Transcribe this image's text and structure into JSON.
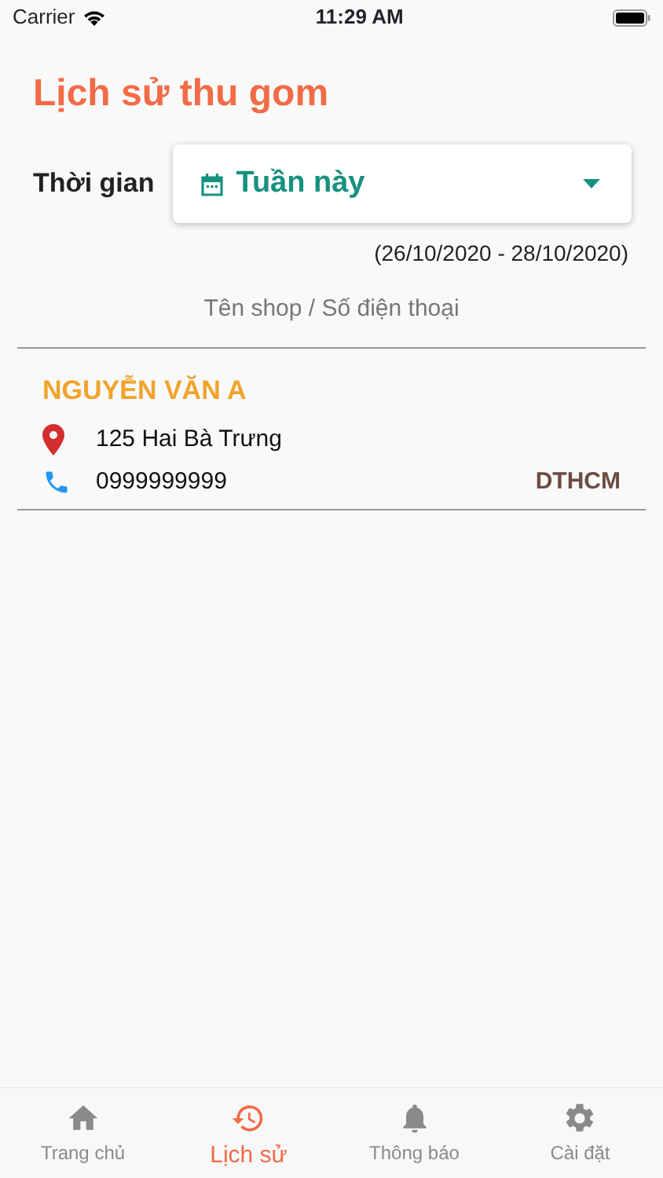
{
  "status_bar": {
    "carrier": "Carrier",
    "time": "11:29 AM"
  },
  "title": "Lịch sử thu gom",
  "period": {
    "label": "Thời gian",
    "value": "Tuần này",
    "range": "(26/10/2020 - 28/10/2020)"
  },
  "search": {
    "placeholder": "Tên shop / Số điện thoại"
  },
  "records": [
    {
      "name": "NGUYỄN VĂN A",
      "address": "125 Hai Bà Trưng",
      "phone": "0999999999",
      "code": "DTHCM"
    }
  ],
  "tabs": [
    {
      "kind": "home",
      "label": "Trang chủ",
      "selected": false
    },
    {
      "kind": "history",
      "label": "Lịch sử",
      "selected": true
    },
    {
      "kind": "bell",
      "label": "Thông báo",
      "selected": false
    },
    {
      "kind": "gear",
      "label": "Cài đặt",
      "selected": false
    }
  ]
}
